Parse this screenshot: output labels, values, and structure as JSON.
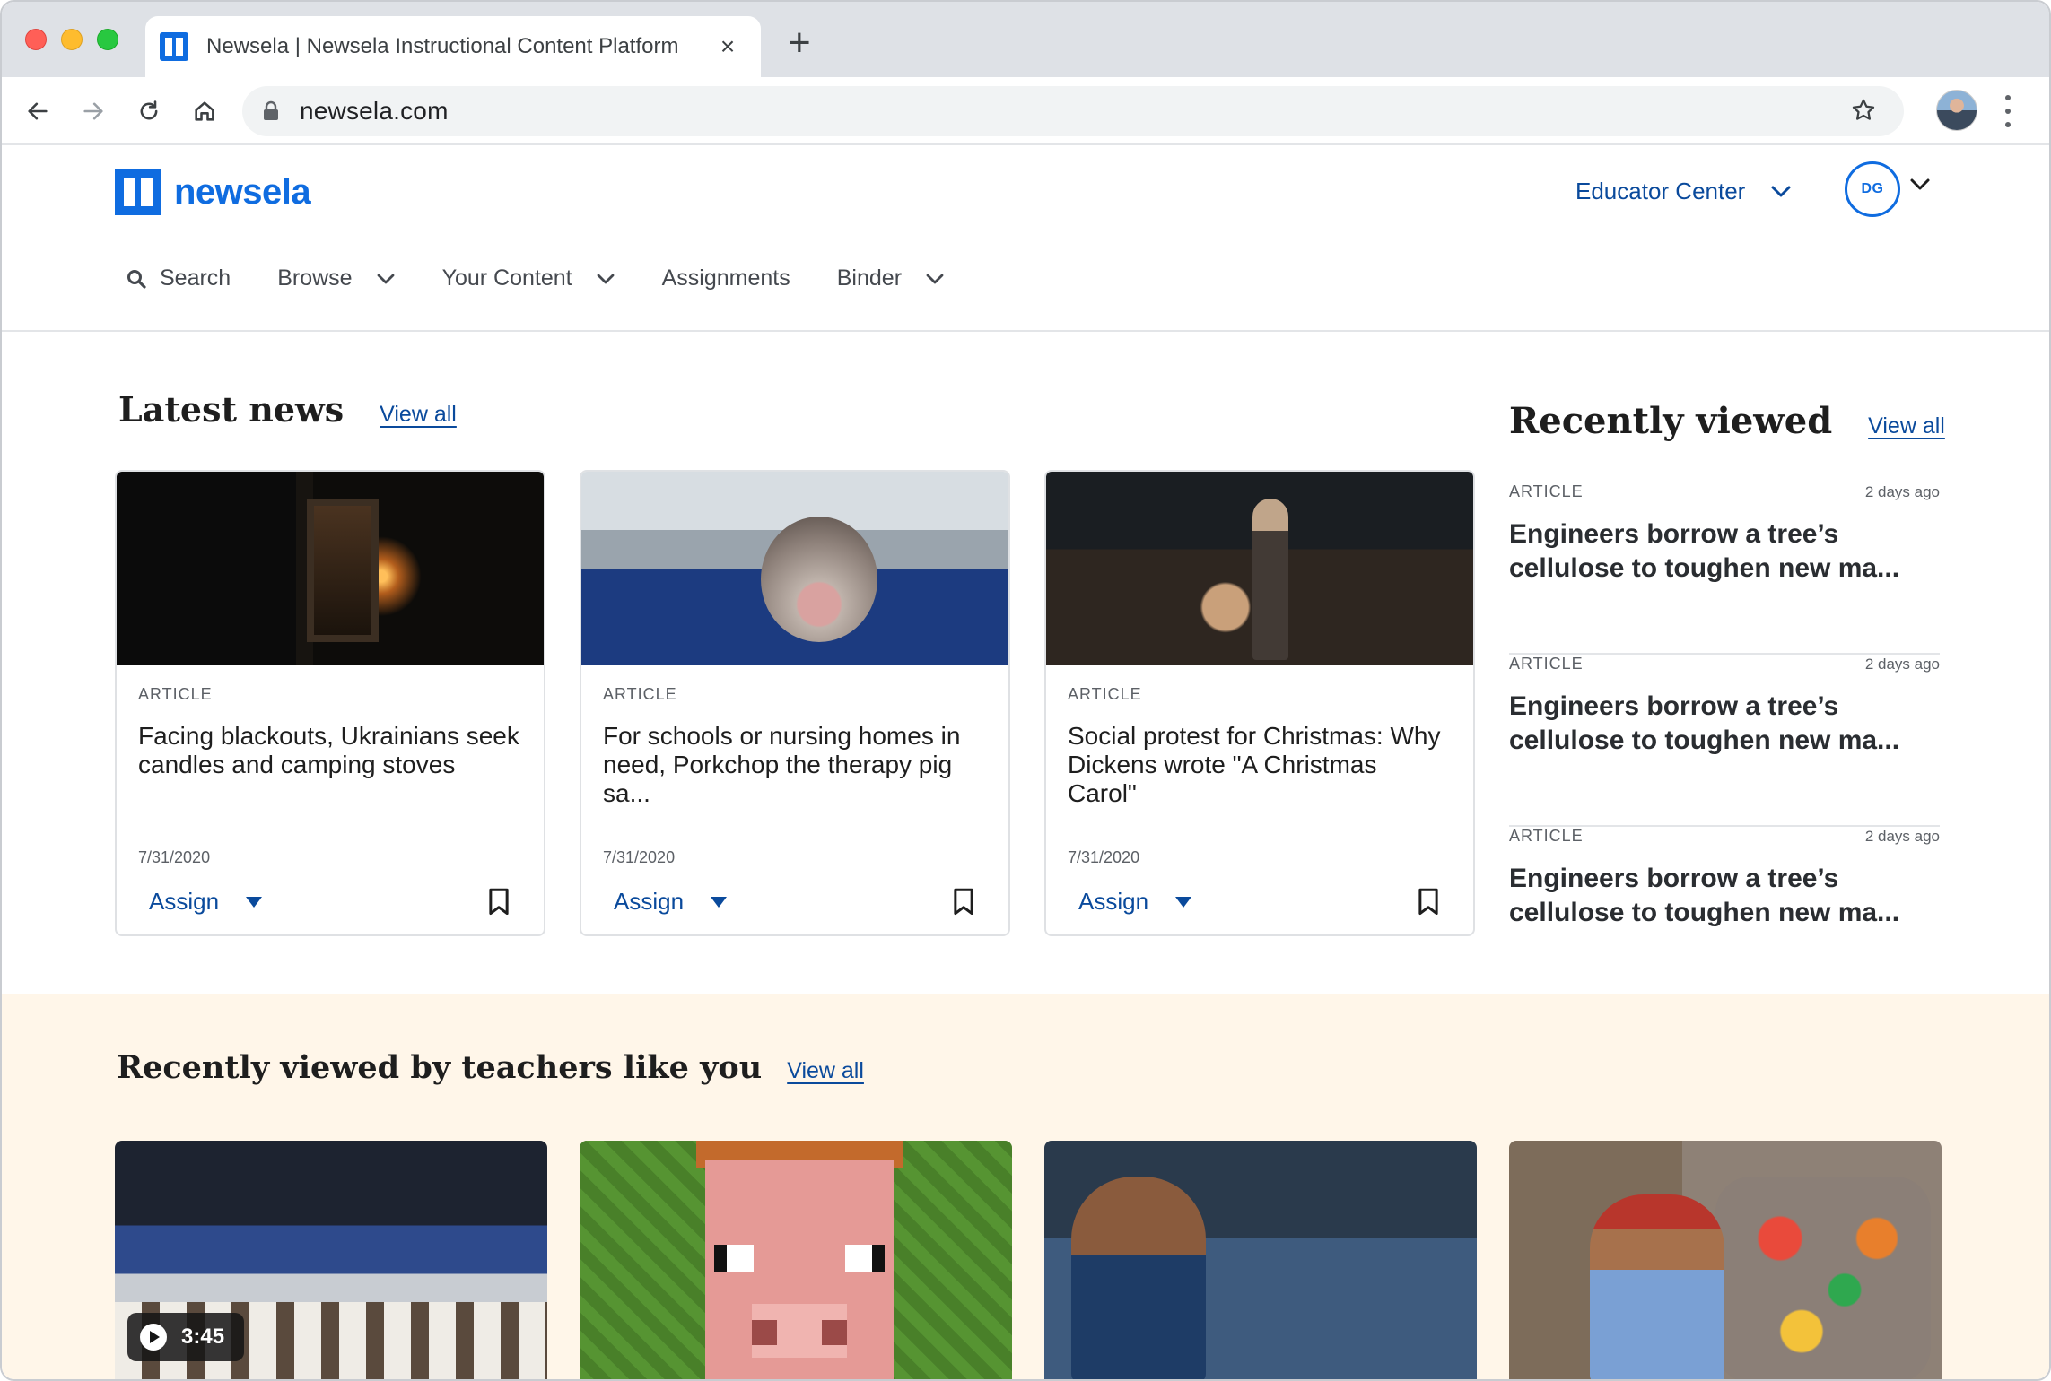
{
  "browser": {
    "tab_title": "Newsela | Newsela Instructional Content Platform",
    "url": "newsela.com"
  },
  "site": {
    "logo_text": "newsela",
    "educator_center": "Educator Center",
    "avatar_initials": "DG",
    "brand_color": "#0f6ce0",
    "link_color": "#0a4a9c",
    "nav": {
      "search": "Search",
      "browse": "Browse",
      "your_content": "Your Content",
      "assignments": "Assignments",
      "binder": "Binder"
    }
  },
  "latest_news": {
    "title": "Latest news",
    "view_all": "View all",
    "cards": [
      {
        "type": "ARTICLE",
        "title": "Facing blackouts, Ukrainians seek candles and camping stoves",
        "date": "7/31/2020",
        "assign": "Assign"
      },
      {
        "type": "ARTICLE",
        "title": "For schools or nursing homes in need, Porkchop the therapy pig sa...",
        "date": "7/31/2020",
        "assign": "Assign"
      },
      {
        "type": "ARTICLE",
        "title": "Social protest for Christmas: Why Dickens wrote \"A Christmas Carol\"",
        "date": "7/31/2020",
        "assign": "Assign"
      }
    ]
  },
  "recently_viewed": {
    "title": "Recently viewed",
    "view_all": "View all",
    "items": [
      {
        "type": "ARTICLE",
        "when": "2 days ago",
        "title": "Engineers borrow a tree’s cellulose to toughen new ma..."
      },
      {
        "type": "ARTICLE",
        "when": "2 days ago",
        "title": "Engineers borrow a tree’s cellulose to toughen new ma..."
      },
      {
        "type": "ARTICLE",
        "when": "2 days ago",
        "title": "Engineers borrow a tree’s cellulose to toughen new ma..."
      }
    ]
  },
  "teachers": {
    "title": "Recently viewed by teachers like you",
    "view_all": "View all",
    "video_duration": "3:45",
    "background_color": "#fff6e9"
  }
}
